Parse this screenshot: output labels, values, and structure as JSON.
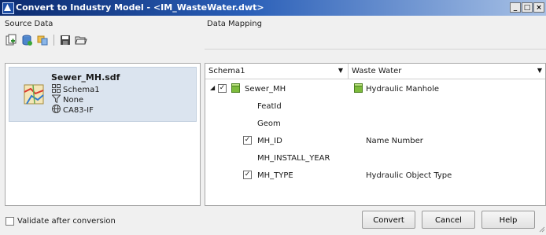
{
  "window": {
    "title": "Convert to Industry Model - <IM_WasteWater.dwt>",
    "controls": {
      "minimize": "_",
      "maximize": "□",
      "close": "×"
    }
  },
  "source_panel": {
    "label": "Source Data",
    "toolbar_icons": [
      "add-source-icon",
      "database-icon",
      "connect-icon",
      "save-icon",
      "open-folder-icon"
    ],
    "source": {
      "name": "Sewer_MH.sdf",
      "schema": "Schema1",
      "filter": "None",
      "coordinate_system": "CA83-IF"
    }
  },
  "mapping_panel": {
    "label": "Data Mapping",
    "schema_select": "Schema1",
    "model_select": "Waste Water",
    "rows": [
      {
        "source": "Sewer_MH",
        "target": "Hydraulic Manhole",
        "checked": true,
        "is_class": true
      },
      {
        "source": "FeatId",
        "target": "",
        "checked": false
      },
      {
        "source": "Geom",
        "target": "",
        "checked": false
      },
      {
        "source": "MH_ID",
        "target": "Name Number",
        "checked": true
      },
      {
        "source": "MH_INSTALL_YEAR",
        "target": "",
        "checked": false
      },
      {
        "source": "MH_TYPE",
        "target": "Hydraulic Object Type",
        "checked": true
      }
    ]
  },
  "footer": {
    "validate_label": "Validate after conversion",
    "validate_checked": false,
    "convert_label": "Convert",
    "cancel_label": "Cancel",
    "help_label": "Help"
  },
  "colors": {
    "title_bar_start": "#0b2a6e",
    "selected_source_bg": "#dbe4ef",
    "class_icon_green": "#7dbb3c"
  }
}
